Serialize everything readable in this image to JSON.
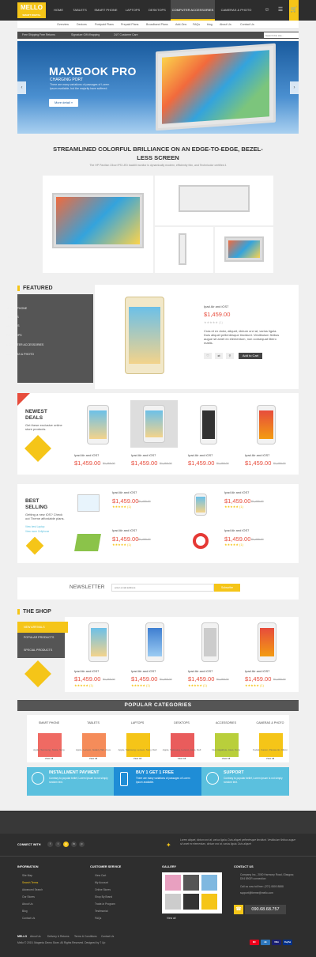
{
  "nav": {
    "logo": "MELLO",
    "logo_tag": "SMART DIGITAL",
    "items": [
      "HOME",
      "TABLETS",
      "SMART PHONE",
      "LAPTOPS",
      "DESKTOPS",
      "COMPUTER ACCESSORIES",
      "CAMERAS & PHOTO"
    ],
    "active_index": 5,
    "icons": [
      "user-icon",
      "menu-icon",
      "cart-icon"
    ]
  },
  "subnav": [
    "Overview",
    "Devices",
    "Postpaid Plans",
    "Prepaid Plans",
    "Broadband Plans",
    "Add-Ons",
    "FAQs",
    "blog",
    "About Us",
    "Contact Us"
  ],
  "infobar": {
    "items": [
      "Free Shipping Free Returns",
      "Signature Gift Wrapping",
      "24/7 Customer Care"
    ],
    "search_placeholder": "Search this site..."
  },
  "hero": {
    "title": "MAXBOOK PRO",
    "subtitle": "CHARGING PORT",
    "desc": "There are many variations of passages of Lorem Ipsum available, but the majority have suffered.",
    "button": "More detail »"
  },
  "headline": {
    "title": "STREAMLINED COLORFUL BRILLIANCE ON AN EDGE-TO-EDGE, BEZEL-LESS SCREEN",
    "sub": "The HP Pavilion 23xw IPS LED backlit monitor is dynamically modern, efficiently thin, and Technicolor certified.1"
  },
  "featured": {
    "title": "FEATURED",
    "categories": [
      "SMART PHONE",
      "TABLETS",
      "LAPTOPS",
      "DESKTOPS",
      "COMPUTER ACCESSORIES",
      "CAMERAS & PHOTO"
    ],
    "product": {
      "name": "Ipad Air and iOS7",
      "price": "$1,459.00",
      "rating": "(1)",
      "desc": "Cras et ex dolor, aliquet, dictum orci at, varius ligula. Duis aliquet pellentesque tincidunt. Vestibulum finibus augue sit amet ex elementum, non consequat libero mattis.",
      "button": "Add to Cart"
    }
  },
  "newest": {
    "title": "NEWEST DEALS",
    "desc": "Get these exclusive online store products.",
    "products": [
      {
        "name": "Ipad Air and iOS7",
        "price": "$1,459.00",
        "old": "$1,469.00"
      },
      {
        "name": "Ipad Air and iOS7",
        "price": "$1,459.00",
        "old": "$1,469.00"
      },
      {
        "name": "Ipad Air and iOS7",
        "price": "$1,459.00",
        "old": "$1,469.00"
      },
      {
        "name": "Ipad Air and iOS7",
        "price": "$1,459.00",
        "old": "$1,469.00"
      }
    ]
  },
  "best": {
    "title": "BEST SELLING",
    "desc": "Getting a new iOS? Check out Theme affordable plans.",
    "links": [
      "View best Laptop",
      "View more Cellphone"
    ],
    "products": [
      {
        "name": "Ipad Air and iOS7",
        "price": "$1,459.00",
        "old": "$1,469.00",
        "rating": "(1)"
      },
      {
        "name": "Ipad Air and iOS7",
        "price": "$1,459.00",
        "old": "$1,469.00",
        "rating": "(1)"
      },
      {
        "name": "Ipad Air and iOS7",
        "price": "$1,459.00",
        "old": "$1,469.00",
        "rating": "(1)"
      },
      {
        "name": "Ipad Air and iOS7",
        "price": "$1,459.00",
        "old": "$1,469.00",
        "rating": "(1)"
      }
    ]
  },
  "newsletter": {
    "title": "NEWSLETTER",
    "placeholder": "enter email address",
    "button": "Subscribe"
  },
  "shop": {
    "title": "THE SHOP",
    "tabs": [
      "NEW ARRIVALS",
      "POPULAR PRODUCTS",
      "SPECIAL PRODUCTS"
    ],
    "products": [
      {
        "name": "Ipad Air and iOS7",
        "price": "$1,459.00",
        "old": "$1,469.00",
        "rating": "(1)"
      },
      {
        "name": "Ipad Air and iOS7",
        "price": "$1,459.00",
        "old": "$1,469.00",
        "rating": "(1)"
      },
      {
        "name": "Ipad Air and iOS7",
        "price": "$1,459.00",
        "old": "$1,469.00",
        "rating": "(1)"
      },
      {
        "name": "Ipad Air and iOS7",
        "price": "$1,459.00",
        "old": "$1,469.00",
        "rating": "(1)"
      }
    ]
  },
  "popular": {
    "title": "POPULAR CATEGORIES",
    "cats": [
      {
        "label": "SMART PHONE",
        "text": "Apple, Samsung, Nokia, Sony",
        "link": "View All",
        "color": "#ef6a63"
      },
      {
        "label": "TABLETS",
        "text": "Apple, Lenovo, Galaxy Tab, Asus",
        "link": "View All",
        "color": "#f58c5a"
      },
      {
        "label": "LAPTOPS",
        "text": "Apple, Samsung, Lenovo, Sony, Dell",
        "link": "View All",
        "color": "#f5c518"
      },
      {
        "label": "DESKTOPS",
        "text": "Apple, Samsung, Lenovo, Asus, Dell",
        "link": "View All",
        "color": "#e95c5c"
      },
      {
        "label": "ACCESSORIES",
        "text": "Intel, Gigabyte, Asus, Sony",
        "link": "View All",
        "color": "#b9cf3b"
      },
      {
        "label": "CAMERAS & PHOTO",
        "text": "Kodak, Canon, Panasonic, Nikon",
        "link": "View All",
        "color": "#f5c518"
      }
    ]
  },
  "services": [
    {
      "title": "INSTALLMENT PAYMENT",
      "desc": "Contrary to popular belief, Lorem Ipsum is not simply random text.",
      "color": "#5bc0de"
    },
    {
      "title": "BUY 1 GET 1 FREE",
      "desc": "There are many variations of passages of Lorem Ipsum available.",
      "color": "#1f8dd6"
    },
    {
      "title": "SUPPORT",
      "desc": "Contrary to popular belief, Lorem Ipsum is not simply random text.",
      "color": "#5bc0de"
    }
  ],
  "footer": {
    "connect": "CONNECT WITH",
    "social": [
      "f",
      "t",
      "g",
      "in",
      "p"
    ],
    "tweet": "Lorem aliquet, dictum orci at, varius ligula. Duis aliquet pellentesque tincidunt. Vestibulum finibus augue sit amet ex elementum, dictum orci at, varius ligula. Duis aliquet",
    "info_title": "INFORMATION",
    "info_links": [
      "Site Map",
      "Search Terms",
      "Advanced Search",
      "Our Stores",
      "About Us",
      "Blog",
      "Contact Us"
    ],
    "service_title": "CUSTOMER SERVICE",
    "service_links": [
      "View Cart",
      "My Account",
      "Online Stores",
      "Shop By Brand",
      "Trade-in Program",
      "Testimonial",
      "FAQs"
    ],
    "gallery_title": "GALLERY",
    "gallery_link": "View all",
    "contact_title": "CONTACT US",
    "contact": [
      "Company Inc., 2000 Harmony Road, Glasgow, D04 89GR connection",
      "Call us now toll free: (707) 0800 8888",
      "support@theme@mello.com"
    ],
    "phone": "090.68.68.757",
    "bottom_links": [
      "About Us",
      "Delivery & Returns",
      "Terms & Conditions",
      "Contact Us"
    ],
    "brand": "MELLO",
    "copyright": "Mello © 2015. Magento Demo Store. All Rights Reserved. Designed by 7 Up",
    "payments": [
      {
        "name": "MC",
        "color": "#eb001b"
      },
      {
        "name": "AE",
        "color": "#2e77bc"
      },
      {
        "name": "VISA",
        "color": "#1a1f71"
      },
      {
        "name": "PayPal",
        "color": "#003087"
      }
    ]
  }
}
